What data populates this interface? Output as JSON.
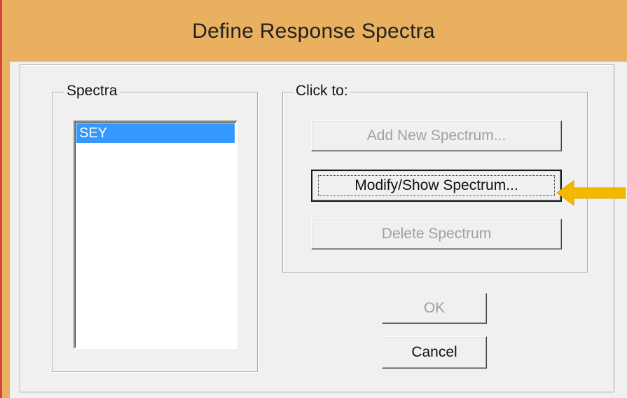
{
  "window": {
    "title": "Define Response Spectra"
  },
  "spectra_group": {
    "legend": "Spectra",
    "items": [
      "SEY"
    ],
    "selected": "SEY"
  },
  "actions_group": {
    "legend": "Click to:",
    "add_button": "Add New Spectrum...",
    "modify_button": "Modify/Show Spectrum...",
    "delete_button": "Delete Spectrum"
  },
  "dialog_buttons": {
    "ok": "OK",
    "cancel": "Cancel"
  },
  "annotation": {
    "arrow_color": "#f5b800"
  }
}
